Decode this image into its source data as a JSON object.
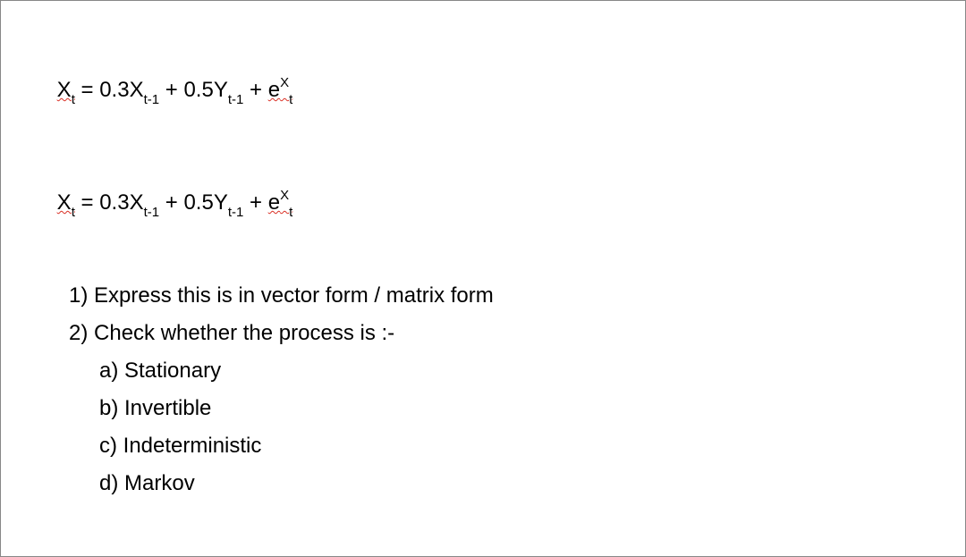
{
  "equations": [
    {
      "parts": {
        "p0": "X",
        "p0_sub": "t",
        "p1": " = 0.3X",
        "p1_sub": "t-1",
        "p2": " + 0.5Y",
        "p2_sub": "t-1",
        "p3": " + ",
        "p4": "e",
        "p4_sup": "X",
        "p4_sub": "t"
      }
    },
    {
      "parts": {
        "p0": "X",
        "p0_sub": "t",
        "p1": " = 0.3X",
        "p1_sub": "t-1",
        "p2": " + 0.5Y",
        "p2_sub": "t-1",
        "p3": " + ",
        "p4": "e",
        "p4_sup": "X",
        "p4_sub": "t"
      }
    }
  ],
  "questions": {
    "q1": "1) Express this is in vector form / matrix form",
    "q2": "2) Check whether the process is :-",
    "subs": {
      "a": "a) Stationary",
      "b": "b) Invertible",
      "c": "c) Indeterministic",
      "d": "d) Markov"
    }
  }
}
